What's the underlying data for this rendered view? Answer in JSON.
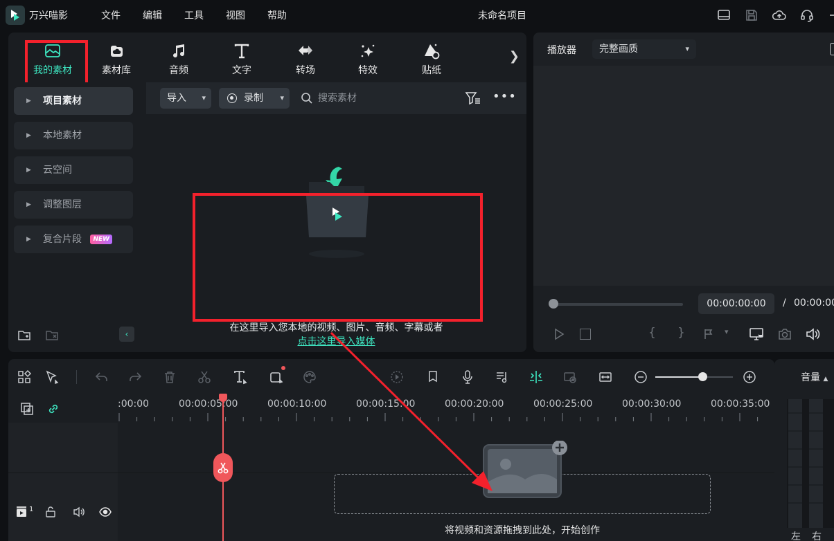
{
  "app": {
    "name": "万兴喵影",
    "project_title": "未命名项目",
    "menu": [
      "文件",
      "编辑",
      "工具",
      "视图",
      "帮助"
    ]
  },
  "media": {
    "tabs": [
      {
        "label": "我的素材",
        "icon": "folder-image-icon",
        "active": true
      },
      {
        "label": "素材库",
        "icon": "cloud-library-icon"
      },
      {
        "label": "音频",
        "icon": "music-note-icon"
      },
      {
        "label": "文字",
        "icon": "text-t-icon"
      },
      {
        "label": "转场",
        "icon": "transition-arrows-icon"
      },
      {
        "label": "特效",
        "icon": "sparkle-effects-icon"
      },
      {
        "label": "贴纸",
        "icon": "sticker-icon"
      }
    ],
    "sidebar": [
      {
        "label": "项目素材",
        "active": true
      },
      {
        "label": "本地素材"
      },
      {
        "label": "云空间"
      },
      {
        "label": "调整图层"
      },
      {
        "label": "复合片段",
        "badge": "NEW"
      }
    ],
    "toolbar": {
      "import_label": "导入",
      "record_label": "录制",
      "search_placeholder": "搜索素材"
    },
    "empty": {
      "message": "在这里导入您本地的视频、图片、音频、字幕或者",
      "link": "点击这里导入媒体"
    }
  },
  "player": {
    "title": "播放器",
    "quality": "完整画质",
    "current_time": "00:00:00:00",
    "separator": "/",
    "total_time": "00:00:00"
  },
  "timeline": {
    "ticks": [
      ":00:00",
      "00:00:05:00",
      "00:00:10:00",
      "00:00:15:00",
      "00:00:20:00",
      "00:00:25:00",
      "00:00:30:00",
      "00:00:35:00"
    ],
    "track_number": "1",
    "drop_hint": "将视频和资源拖拽到此处，开始创作"
  },
  "audio_meter": {
    "title": "音量",
    "left": "左",
    "right": "右"
  },
  "colors": {
    "accent": "#3ee6c1",
    "highlight_box": "#f3212c",
    "playhead": "#f0575b",
    "panel_bg": "#1a1d21"
  }
}
